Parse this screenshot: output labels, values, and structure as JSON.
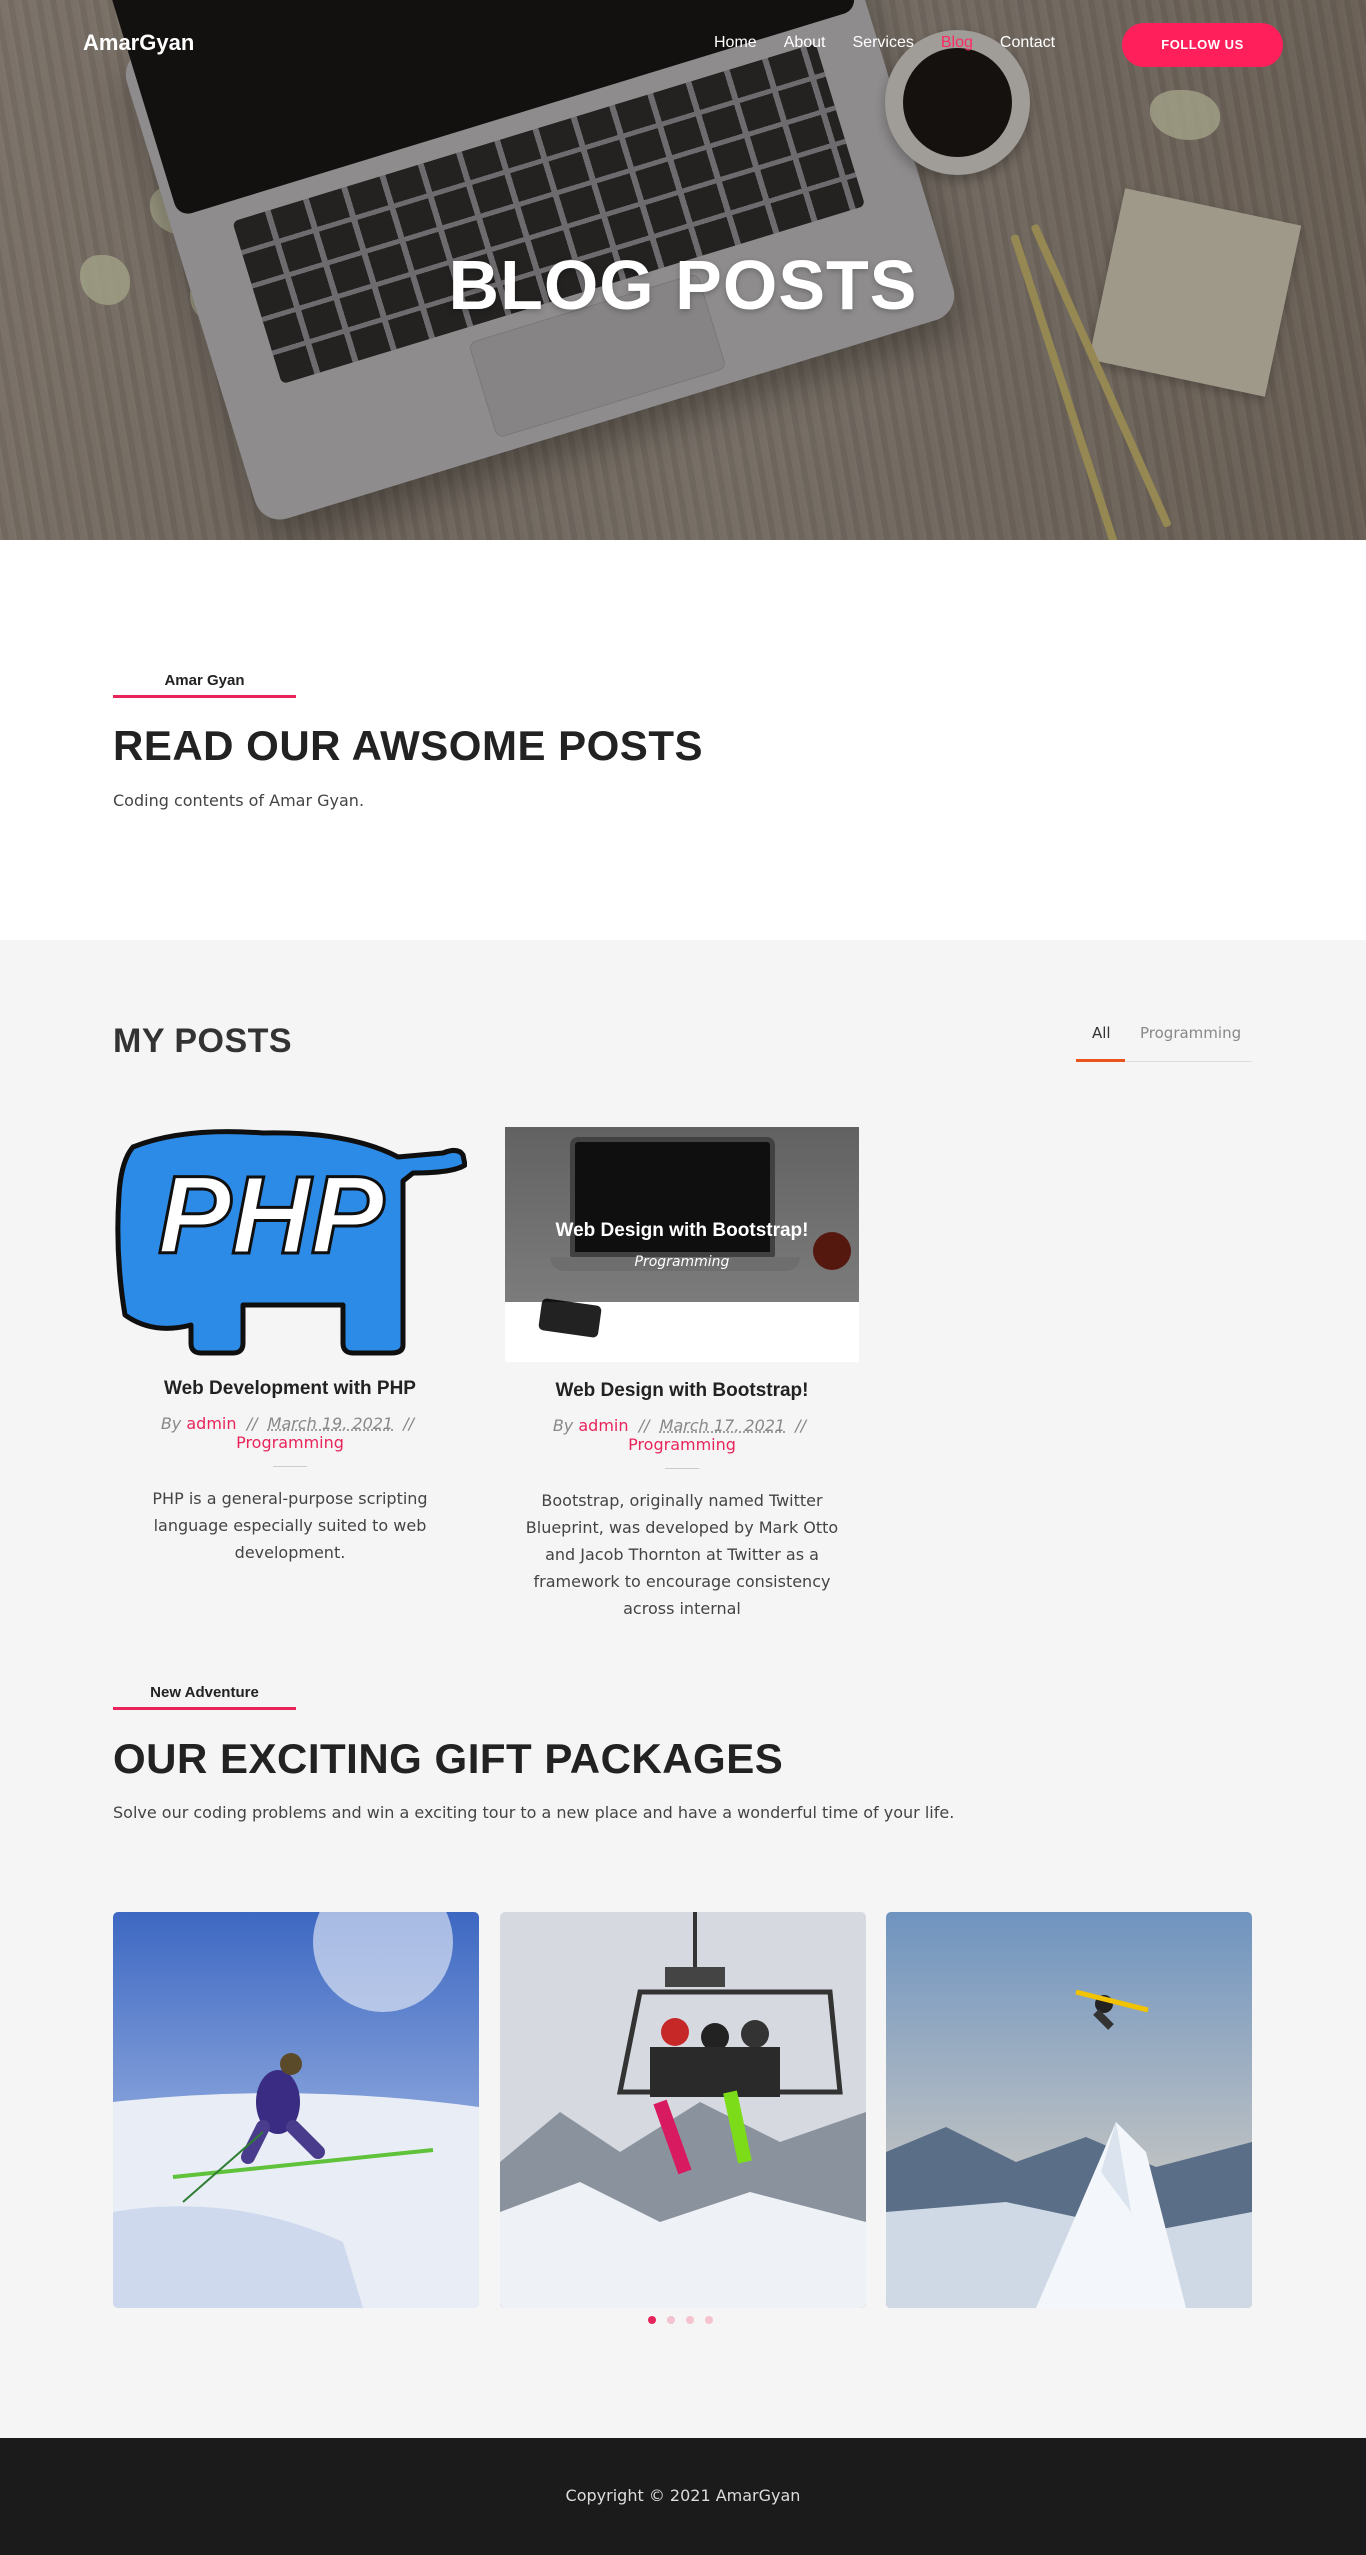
{
  "header": {
    "brand": "AmarGyan",
    "nav": [
      "Home",
      "About",
      "Services",
      "Blog",
      "Contact"
    ],
    "active_nav": "Blog",
    "follow_label": "FOLLOW US",
    "hero_title": "BLOG POSTS"
  },
  "intro": {
    "eyebrow": "Amar Gyan",
    "title": "READ OUR AWSOME POSTS",
    "subtitle": "Coding contents of Amar Gyan."
  },
  "posts": {
    "title": "MY POSTS",
    "filters": [
      "All",
      "Programming"
    ],
    "active_filter": "All",
    "items": [
      {
        "title": "Web Development with PHP",
        "image_text": "PHP",
        "by": "By",
        "author": "admin",
        "date": "March 19, 2021",
        "category": "Programming",
        "excerpt": "PHP is a general-purpose scripting language especially suited to web development."
      },
      {
        "title": "Web Design with Bootstrap!",
        "overlay_title": "Web Design with Bootstrap!",
        "overlay_sub": "Programming",
        "by": "By",
        "author": "admin",
        "date": "March 17, 2021",
        "category": "Programming",
        "excerpt": "Bootstrap, originally named Twitter Blueprint, was developed by Mark Otto and Jacob Thornton at Twitter as a framework to encourage consistency across internal"
      }
    ]
  },
  "packages": {
    "eyebrow": "New Adventure",
    "title": "OUR EXCITING GIFT PACKAGES",
    "subtitle": "Solve our coding problems and win a exciting tour to a new  place and have a wonderful time of your life.",
    "slide_count": 4,
    "active_slide": 0
  },
  "footer": {
    "copyright": "Copyright © 2021 AmarGyan"
  },
  "colors": {
    "accent": "#ff1f5a",
    "filter_underline": "#e8541c",
    "footer_bg": "#1b1b1b"
  }
}
